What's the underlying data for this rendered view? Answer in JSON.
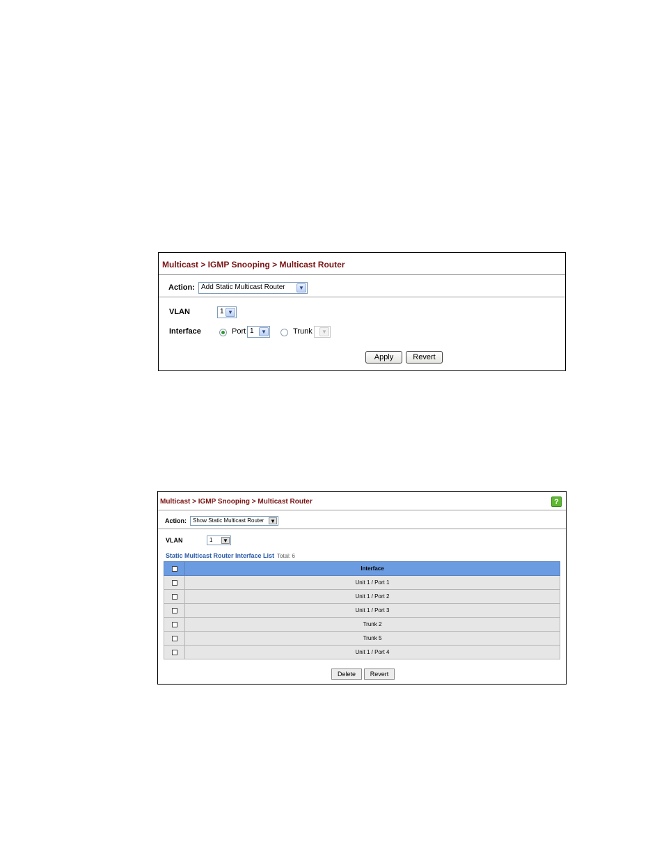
{
  "panel1": {
    "breadcrumb": "Multicast > IGMP Snooping > Multicast Router",
    "action_label": "Action:",
    "action_value": "Add Static Multicast Router",
    "vlan_label": "VLAN",
    "vlan_value": "1",
    "interface_label": "Interface",
    "port_label": "Port",
    "port_value": "1",
    "trunk_label": "Trunk",
    "trunk_value": "",
    "apply_label": "Apply",
    "revert_label": "Revert"
  },
  "panel2": {
    "breadcrumb": "Multicast > IGMP Snooping > Multicast Router",
    "help_glyph": "?",
    "action_label": "Action:",
    "action_value": "Show Static Multicast Router",
    "vlan_label": "VLAN",
    "vlan_value": "1",
    "list_title": "Static Multicast Router Interface List",
    "list_total": "Total: 6",
    "table": {
      "header": "Interface",
      "rows": [
        "Unit 1 / Port 1",
        "Unit 1 / Port 2",
        "Unit 1 / Port 3",
        "Trunk 2",
        "Trunk 5",
        "Unit 1 / Port 4"
      ]
    },
    "delete_label": "Delete",
    "revert_label": "Revert"
  },
  "icons": {
    "dropdown": "chevron-down-icon",
    "help": "help-icon"
  }
}
